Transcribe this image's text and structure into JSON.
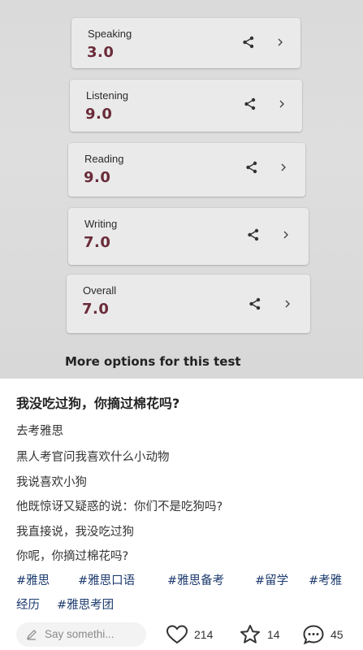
{
  "photo": {
    "cards": [
      {
        "label": "Speaking",
        "score": "3.0"
      },
      {
        "label": "Listening",
        "score": "9.0"
      },
      {
        "label": "Reading",
        "score": "9.0"
      },
      {
        "label": "Writing",
        "score": "7.0"
      },
      {
        "label": "Overall",
        "score": "7.0"
      }
    ],
    "more_options": "More options for this test"
  },
  "post": {
    "title": "我没吃过狗，你摘过棉花吗?",
    "lines": [
      "去考雅思",
      "黑人考官问我喜欢什么小动物",
      "我说喜欢小狗",
      "他既惊讶又疑惑的说：你们不是吃狗吗?",
      "我直接说，我没吃过狗",
      "你呢，你摘过棉花吗?"
    ],
    "tags_line1": [
      "#雅思",
      "#雅思口语",
      "#雅思备考",
      "#留学",
      "#考雅"
    ],
    "tags_line2": [
      "经历",
      "#雅思考团"
    ]
  },
  "bottom_bar": {
    "comment_placeholder": "Say somethi...",
    "likes": "214",
    "favorites": "14",
    "comments": "45"
  },
  "colors": {
    "score": "#6a2b39",
    "tag": "#1d3b6e"
  }
}
